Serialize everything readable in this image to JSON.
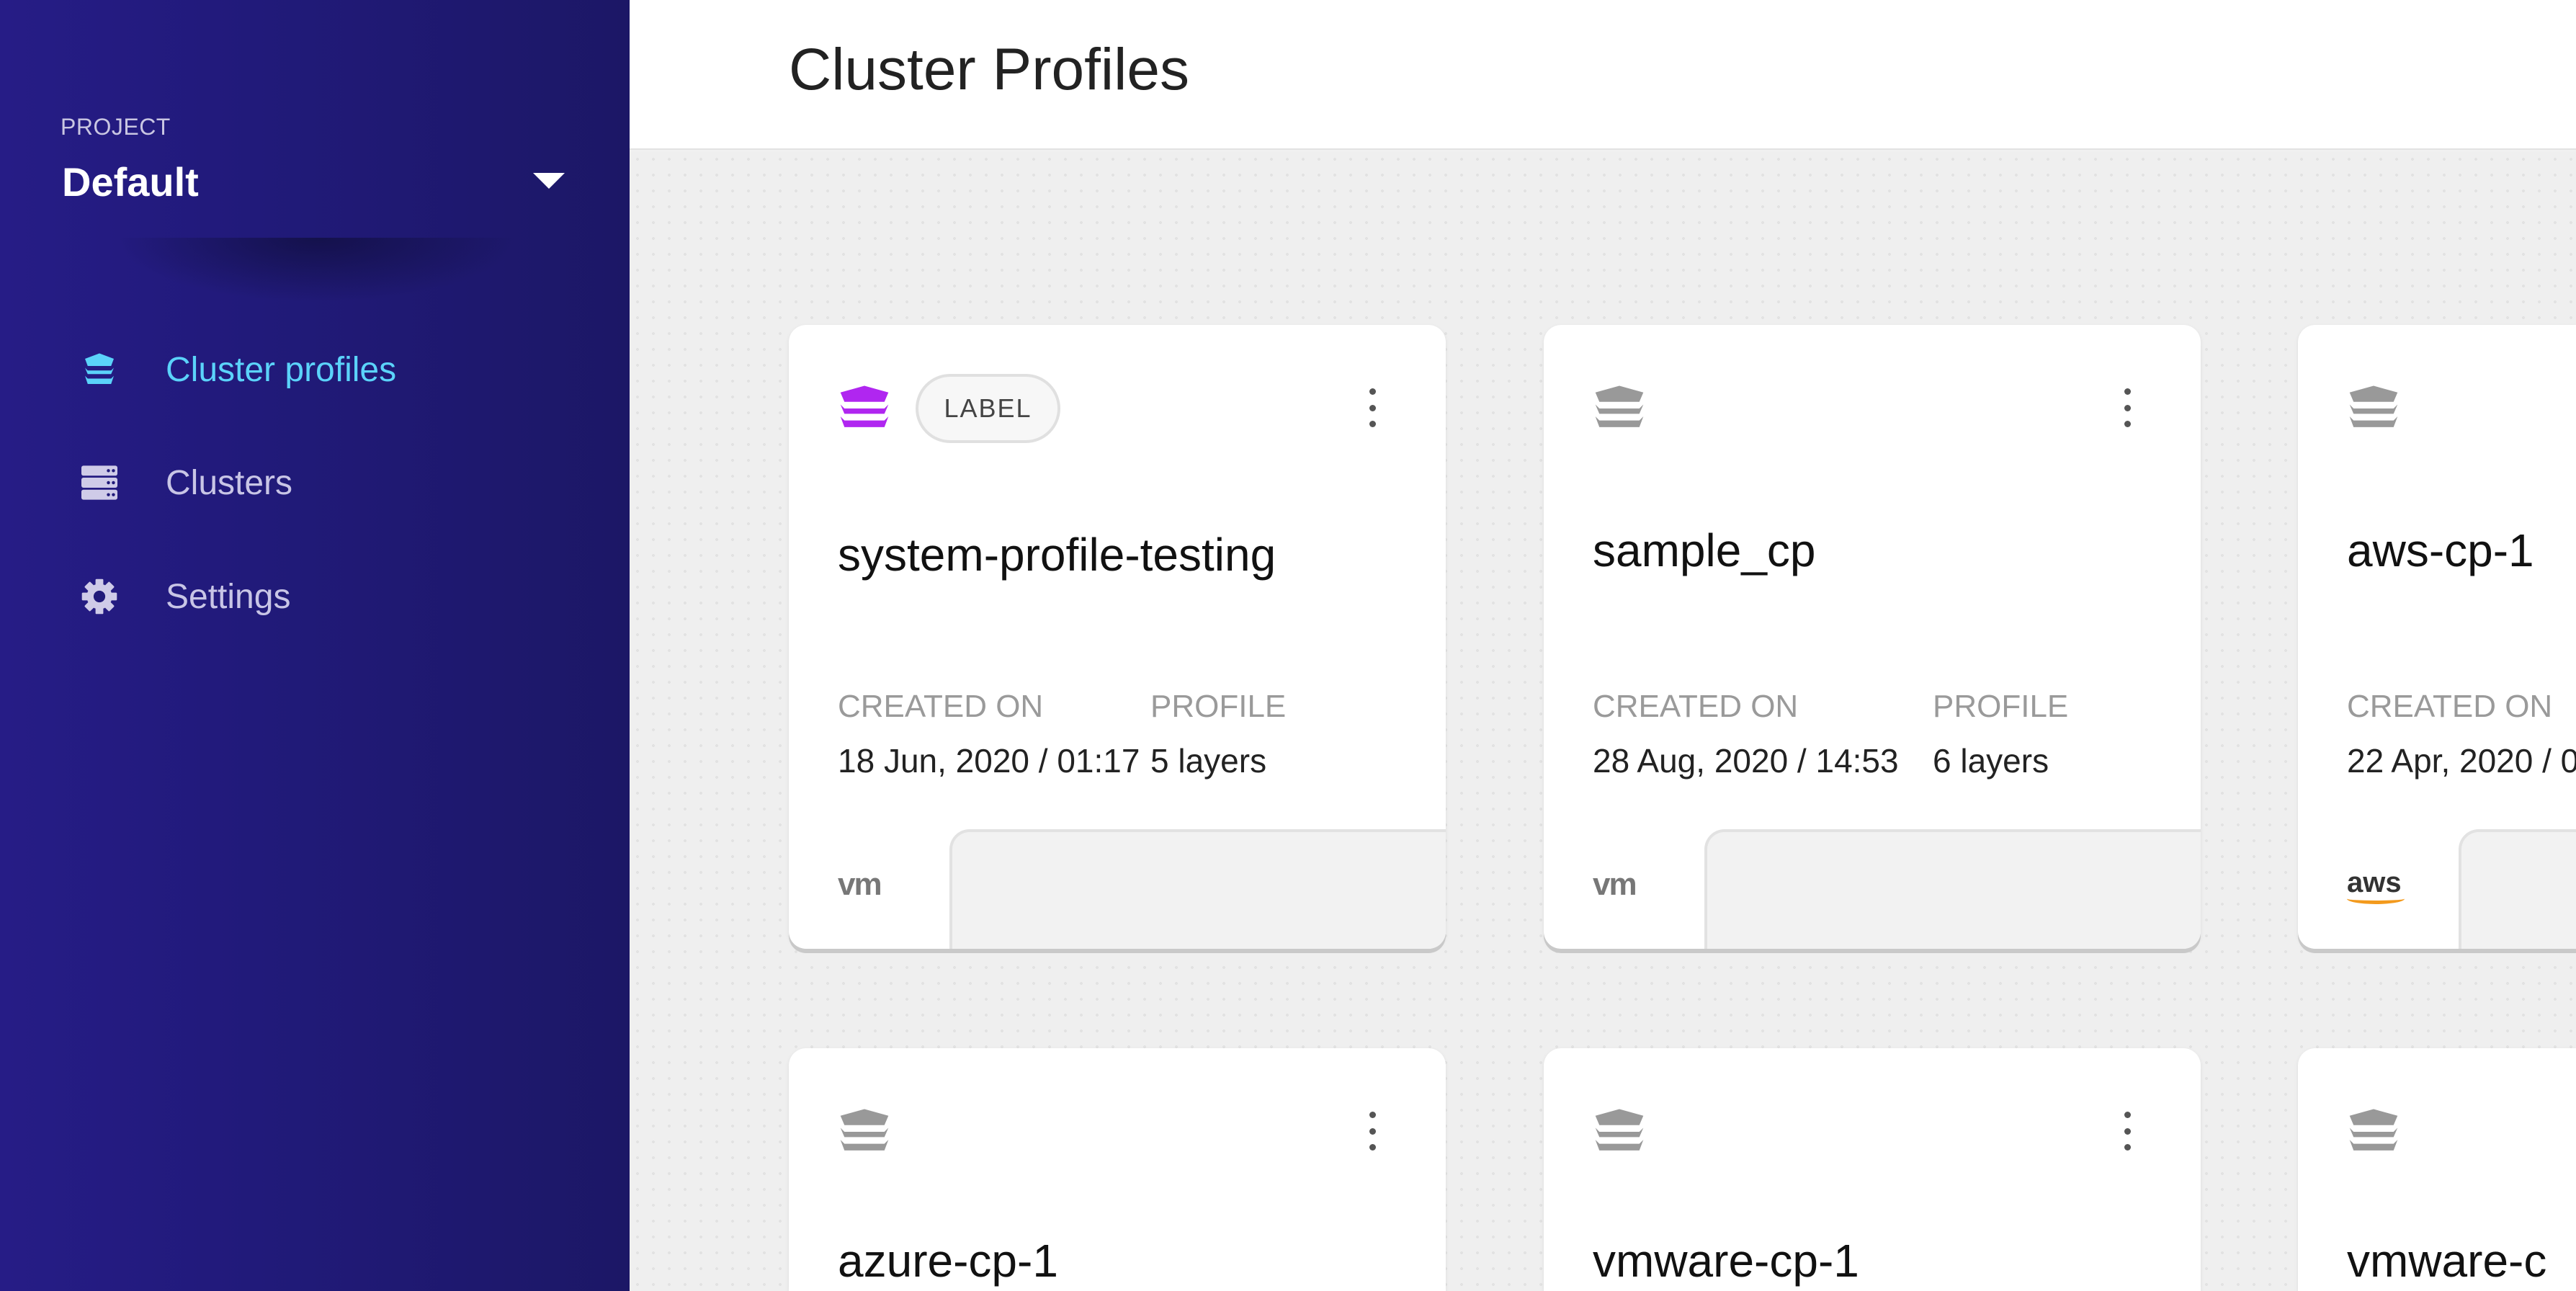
{
  "sidebar": {
    "project_label": "PROJECT",
    "project_value": "Default",
    "items": [
      {
        "label": "Cluster profiles",
        "icon": "layers-icon",
        "active": true
      },
      {
        "label": "Clusters",
        "icon": "server-icon"
      },
      {
        "label": "Settings",
        "icon": "gear-icon"
      }
    ]
  },
  "header": {
    "title": "Cluster Profiles"
  },
  "colors": {
    "accent": "#5bd3fa",
    "sidebar": "#211a7a",
    "label_icon": "#b026f0"
  },
  "card_labels": {
    "created_on": "CREATED ON",
    "profile": "PROFILE"
  },
  "cards": [
    {
      "name": "system-profile-testing",
      "label": "LABEL",
      "created": "18 Jun, 2020 / 01:17",
      "profile": "5 layers",
      "cloud": "vm"
    },
    {
      "name": "sample_cp",
      "created": "28 Aug, 2020 / 14:53",
      "profile": "6 layers",
      "cloud": "vm"
    },
    {
      "name": "aws-cp-1",
      "created": "22 Apr, 2020 / 0",
      "cloud": "aws"
    },
    {
      "name": "azure-cp-1"
    },
    {
      "name": "vmware-cp-1"
    },
    {
      "name": "vmware-c"
    }
  ]
}
